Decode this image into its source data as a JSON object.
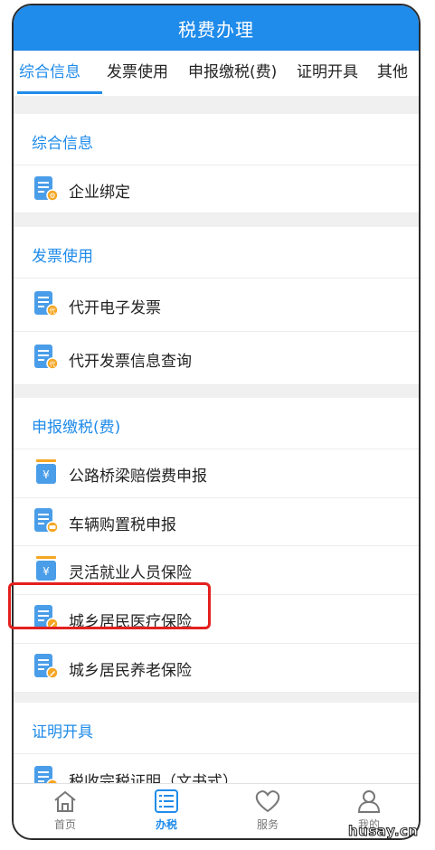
{
  "header": {
    "title": "税费办理"
  },
  "tabs": [
    {
      "label": "综合信息",
      "active": true
    },
    {
      "label": "发票使用",
      "active": false
    },
    {
      "label": "申报缴税(费)",
      "active": false
    },
    {
      "label": "证明开具",
      "active": false
    },
    {
      "label": "其他",
      "active": false
    }
  ],
  "sections": {
    "general": {
      "title": "综合信息",
      "items": [
        "企业绑定"
      ]
    },
    "invoice": {
      "title": "发票使用",
      "items": [
        "代开电子发票",
        "代开发票信息查询"
      ]
    },
    "declare": {
      "title": "申报缴税(费)",
      "items": [
        "公路桥梁赔偿费申报",
        "车辆购置税申报",
        "灵活就业人员保险",
        "城乡居民医疗保险",
        "城乡居民养老保险"
      ]
    },
    "certificate": {
      "title": "证明开具",
      "items": [
        "税收完税证明（文书式）"
      ]
    }
  },
  "bottom_nav": [
    {
      "label": "首页",
      "icon": "home-icon",
      "active": false
    },
    {
      "label": "办税",
      "icon": "list-icon",
      "active": true
    },
    {
      "label": "服务",
      "icon": "heart-icon",
      "active": false
    },
    {
      "label": "我的",
      "icon": "user-icon",
      "active": false
    }
  ],
  "icon_badges": {
    "invoice": "代",
    "money": "¥"
  },
  "highlighted_item": "城乡居民医疗保险",
  "watermark": "husay.cn",
  "colors": {
    "accent": "#1f8bea",
    "highlight": "#e3201e",
    "badge": "#f5a623"
  }
}
